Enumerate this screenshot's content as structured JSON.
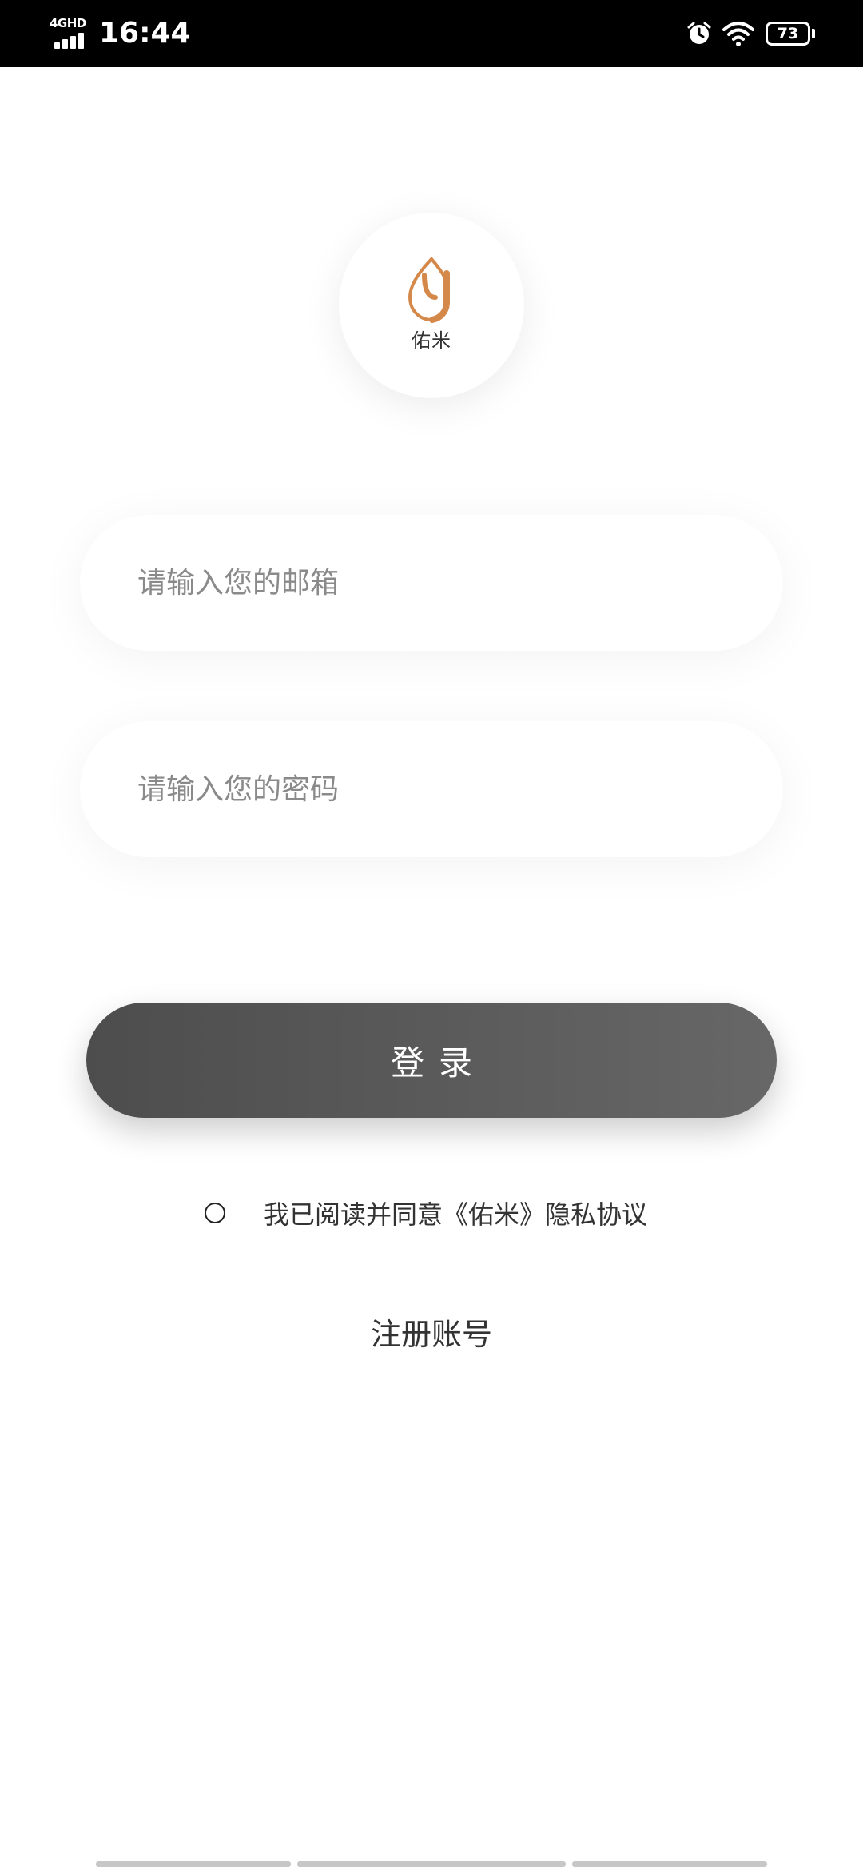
{
  "status_bar": {
    "network": "4GHD",
    "time": "16:44",
    "battery": "73"
  },
  "logo": {
    "text": "佑米",
    "brand_color": "#d4894a"
  },
  "form": {
    "email_placeholder": "请输入您的邮箱",
    "password_placeholder": "请输入您的密码",
    "login_label": "登录"
  },
  "agreement": {
    "text": "我已阅读并同意《佑米》隐私协议",
    "checked": false
  },
  "register": {
    "label": "注册账号"
  },
  "icons": {
    "status": [
      "signal-icon",
      "alarm-icon",
      "wifi-icon",
      "battery-icon"
    ]
  },
  "colors": {
    "button_start": "#4d4d4d",
    "button_end": "#676767",
    "placeholder": "#8a8a8a",
    "text": "#333333"
  }
}
